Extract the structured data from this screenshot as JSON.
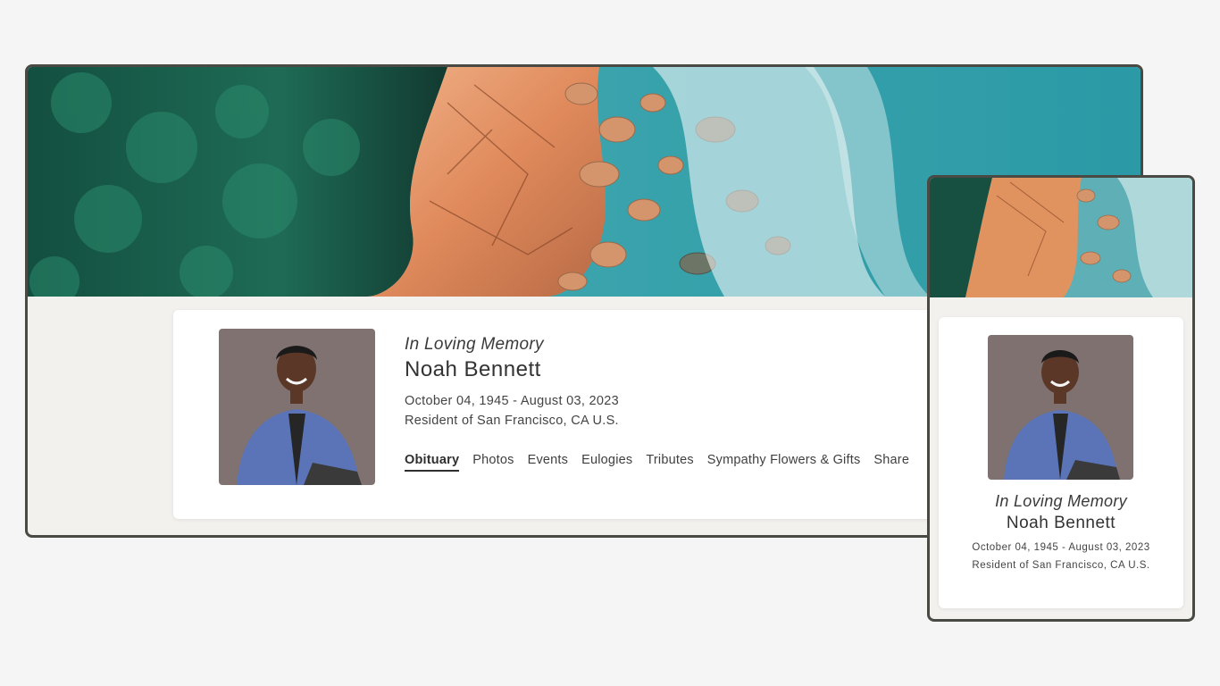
{
  "profile": {
    "memory_heading": "In Loving Memory",
    "name": "Noah Bennett",
    "dates": "October 04, 1945 - August 03, 2023",
    "residence": "Resident of San Francisco, CA U.S."
  },
  "nav": {
    "items": [
      {
        "label": "Obituary",
        "active": true
      },
      {
        "label": "Photos",
        "active": false
      },
      {
        "label": "Events",
        "active": false
      },
      {
        "label": "Eulogies",
        "active": false
      },
      {
        "label": "Tributes",
        "active": false
      },
      {
        "label": "Sympathy Flowers & Gifts",
        "active": false
      },
      {
        "label": "Share",
        "active": false
      }
    ]
  },
  "colors": {
    "frame_border": "#4a4a44",
    "page_background": "#f5f5f5",
    "forest": "#1e6b55",
    "rock": "#e39a6c",
    "sea": "#3fa6ae"
  }
}
